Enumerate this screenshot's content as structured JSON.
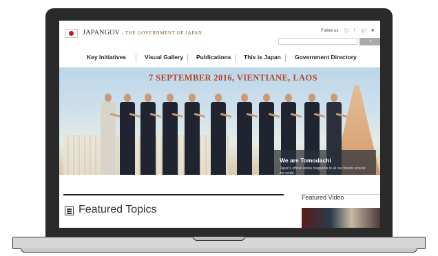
{
  "header": {
    "site_name": "JAPANGOV",
    "site_tagline": " - The Government of Japan",
    "follow_label": "Follow us",
    "search_placeholder": "",
    "search_button_label": ""
  },
  "nav": {
    "items": [
      {
        "label": "Key Initiatives"
      },
      {
        "label": "Visual Gallery"
      },
      {
        "label": "Publications"
      },
      {
        "label": "This is Japan"
      },
      {
        "label": "Government Directory"
      }
    ]
  },
  "hero": {
    "headline": "7 SEPTEMBER 2016, VIENTIANE, LAOS",
    "promo_title": "We are Tomodachi",
    "promo_text": "Japan's official online magazine to all our friends around the world."
  },
  "content": {
    "featured_topics_label": "Featured Topics",
    "featured_video_label": "Featured Video"
  },
  "icons": [
    "japan-flag-icon",
    "twitter-icon",
    "facebook-icon",
    "google-plus-icon",
    "youtube-icon",
    "list-icon"
  ],
  "colors": {
    "headline": "#b3452c",
    "flag_red": "#c8102e",
    "laptop_frame": "#2a2a2a"
  }
}
